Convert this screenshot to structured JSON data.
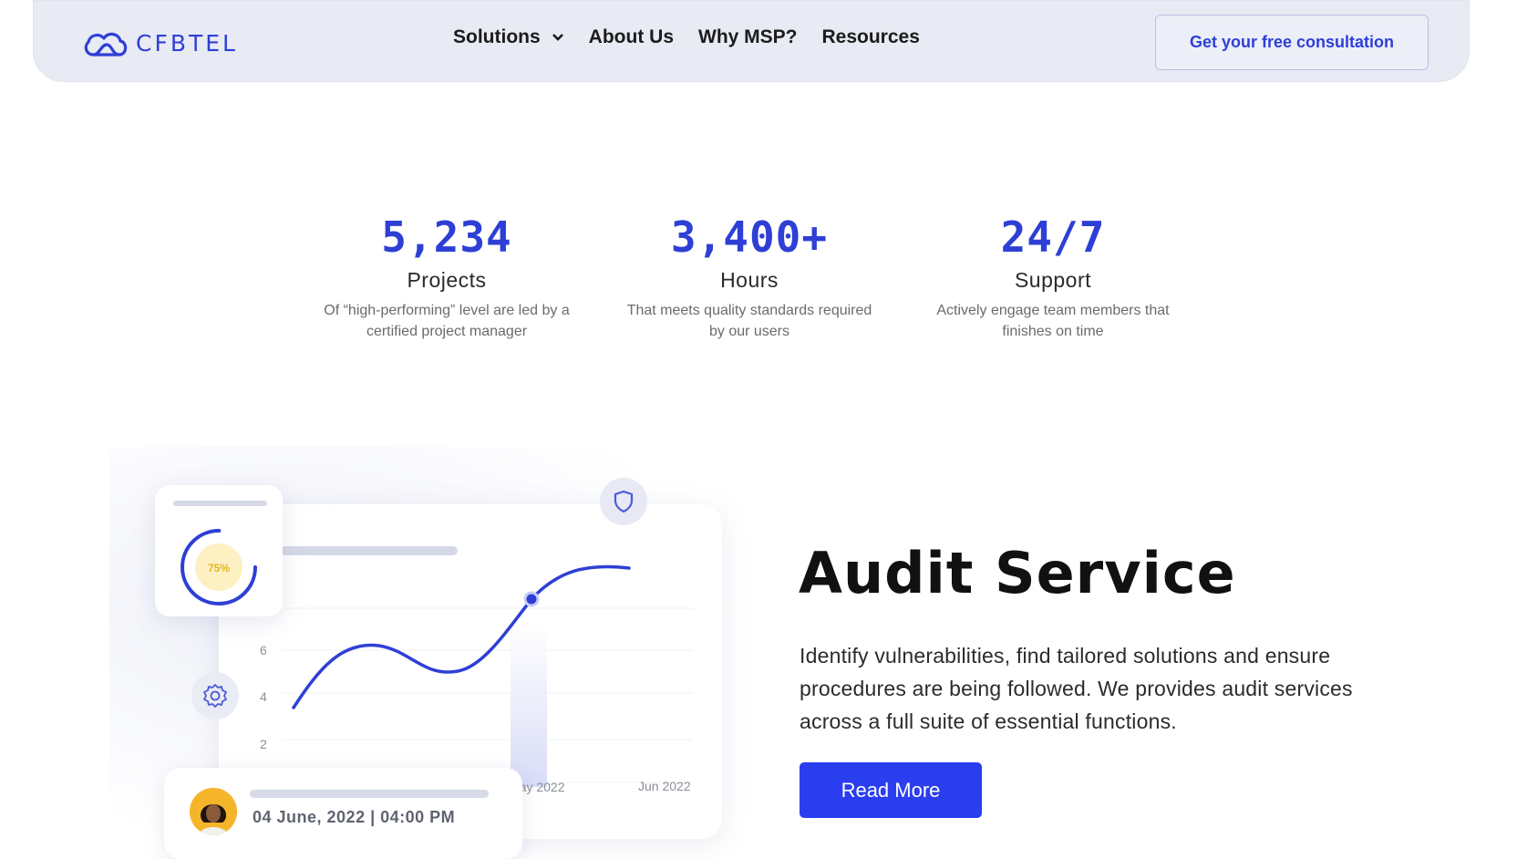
{
  "brand": {
    "name": "CFBTEL",
    "color": "#2e3fd6"
  },
  "nav": {
    "items": [
      {
        "label": "Solutions",
        "has_dropdown": true
      },
      {
        "label": "About Us"
      },
      {
        "label": "Why MSP?"
      },
      {
        "label": "Resources"
      }
    ],
    "cta_label": "Get your free consultation"
  },
  "stats": [
    {
      "value": "5,234",
      "title": "Projects",
      "desc_line1": "Of “high-performing” level are led by a",
      "desc_line2": "certified project manager"
    },
    {
      "value": "3,400+",
      "title": "Hours",
      "desc_line1": "That meets quality standards required",
      "desc_line2": "by our users"
    },
    {
      "value": "24/7",
      "title": "Support",
      "desc_line1": "Actively engage team members that",
      "desc_line2": "finishes on time"
    }
  ],
  "illustration": {
    "gauge": {
      "label": "75%",
      "percent": 75
    },
    "chart": {
      "y_ticks": [
        "6",
        "4",
        "2"
      ],
      "x_labels": [
        "May 2022",
        "Jun 2022"
      ]
    },
    "event": {
      "datetime": "04 June, 2022 | 04:00 PM"
    },
    "icons": [
      "shield-icon",
      "gear-icon"
    ]
  },
  "audit": {
    "title": "Audit Service",
    "desc_line1": "Identify vulnerabilities, find tailored solutions and ensure",
    "desc_line2": "procedures are being followed. We provides audit services",
    "desc_line3": "across a full suite of essential functions.",
    "button_label": "Read More"
  },
  "colors": {
    "accent": "#2e3fd6",
    "button": "#2a3ef0",
    "nav_bg": "#e8eaf4",
    "gauge_yellow": "#f2c230"
  }
}
